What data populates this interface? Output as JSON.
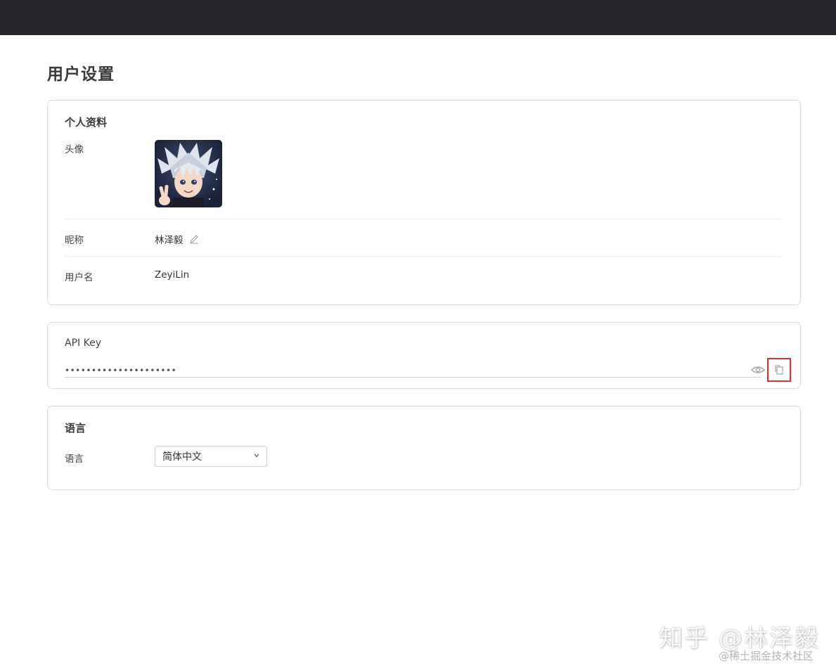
{
  "page": {
    "title": "用户设置"
  },
  "profile": {
    "section_title": "个人资料",
    "avatar_label": "头像",
    "nickname_label": "昵称",
    "nickname_value": "林泽毅",
    "username_label": "用户名",
    "username_value": "ZeyiLin"
  },
  "api": {
    "section_title": "API Key",
    "masked_value": "•••••••••••••••••••••"
  },
  "language": {
    "section_title": "语言",
    "label": "语言",
    "selected": "简体中文"
  },
  "watermark": {
    "main": "知乎 @林泽毅",
    "sub": "@稀土掘金技术社区"
  },
  "colors": {
    "topbar": "#26262b",
    "highlight": "#d03a3a",
    "border": "#dcdcdc"
  },
  "icons": {
    "edit": "pencil-icon",
    "reveal": "eye-icon",
    "copy": "copy-icon",
    "dropdown": "chevron-down-icon"
  }
}
